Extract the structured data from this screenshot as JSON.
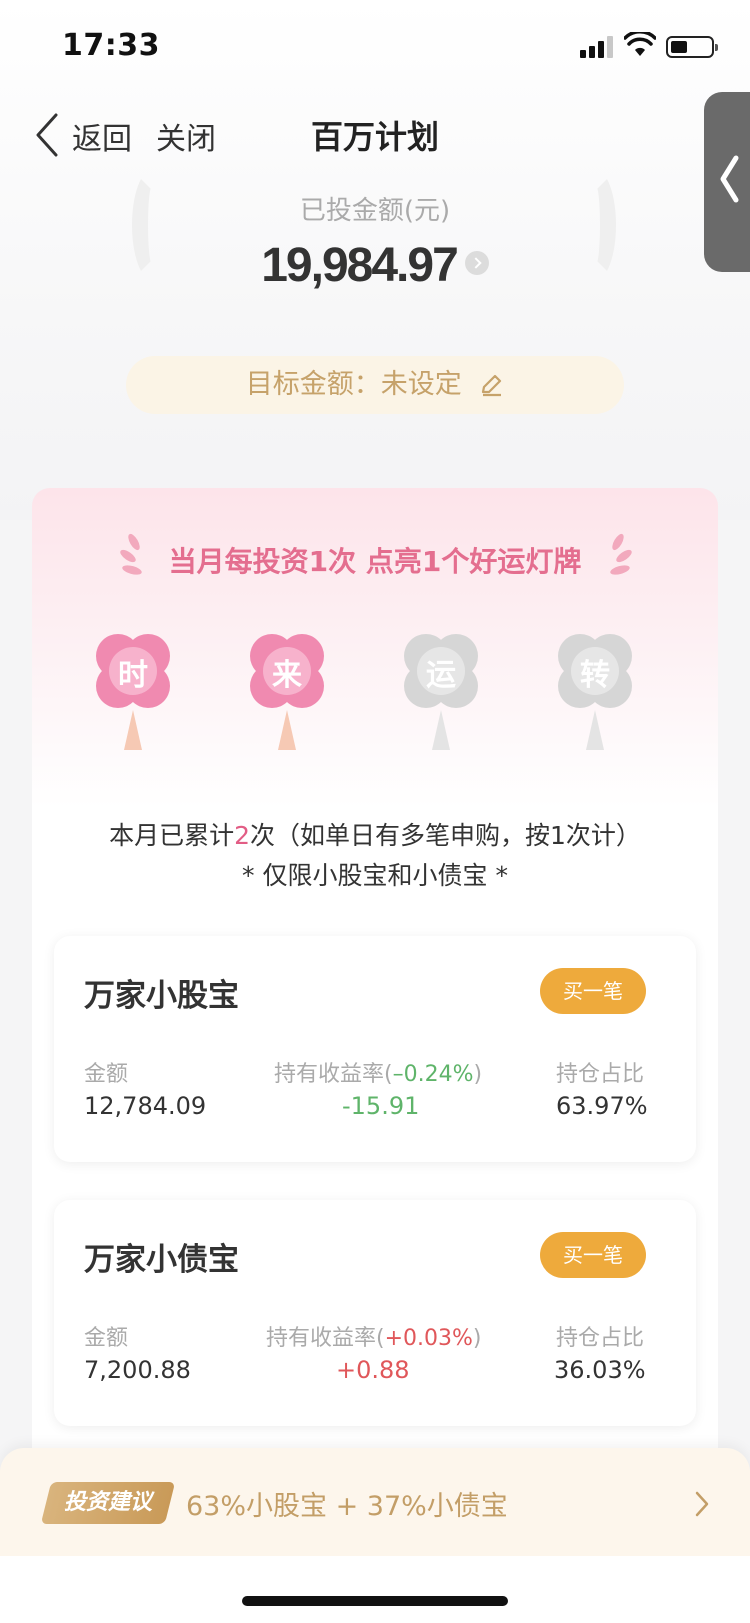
{
  "status_bar": {
    "time": "17:33"
  },
  "nav": {
    "back": "返回",
    "close": "关闭",
    "title": "百万计划"
  },
  "summary": {
    "invested_label": "已投金额(元)",
    "invested_amount": "19,984.97",
    "target_text": "目标金额：未设定"
  },
  "promo": {
    "title": "当月每投资1次 点亮1个好运灯牌",
    "clovers": [
      {
        "char": "时",
        "lit": true
      },
      {
        "char": "来",
        "lit": true
      },
      {
        "char": "运",
        "lit": false
      },
      {
        "char": "转",
        "lit": false
      }
    ],
    "count_prefix": "本月已累计",
    "count_value": "2",
    "count_suffix": "次（如单日有多笔申购，按1次计）",
    "limit_note": "* 仅限小股宝和小债宝 *"
  },
  "funds": [
    {
      "name": "万家小股宝",
      "buy_label": "买一笔",
      "amount_label": "金额",
      "amount": "12,784.09",
      "return_label": "持有收益率(",
      "return_rate": "–0.24%",
      "return_close": ")",
      "return_value": "-15.91",
      "ratio_label": "持仓占比",
      "ratio": "63.97%"
    },
    {
      "name": "万家小债宝",
      "buy_label": "买一笔",
      "amount_label": "金额",
      "amount": "7,200.88",
      "return_label": "持有收益率(",
      "return_rate": "+0.03%",
      "return_close": ")",
      "return_value": "+0.88",
      "ratio_label": "持仓占比",
      "ratio": "36.03%"
    }
  ],
  "advice": {
    "tag": "投资建议",
    "text": "63%小股宝 + 37%小债宝"
  },
  "colors": {
    "accent_pink": "#e46e8f",
    "buy_orange": "#eeaa3c",
    "gain_red": "#e0575a",
    "loss_green": "#5fb46a",
    "gold_text": "#c39e67"
  }
}
